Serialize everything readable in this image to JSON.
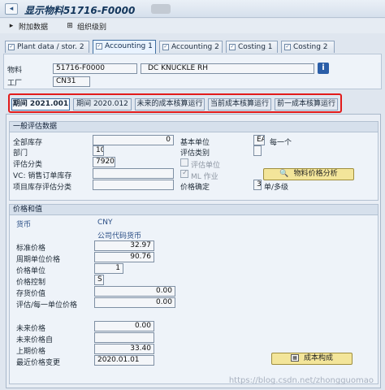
{
  "window": {
    "title": "显示物料51716-F0000"
  },
  "toolbar": {
    "append_data": "附加数据",
    "org_levels": "组织级别"
  },
  "tabs": [
    {
      "label": "Plant data / stor. 2"
    },
    {
      "label": "Accounting 1"
    },
    {
      "label": "Accounting 2"
    },
    {
      "label": "Costing 1"
    },
    {
      "label": "Costing 2"
    }
  ],
  "header": {
    "material_label": "物料",
    "material_value": "51716-F0000",
    "material_desc": "DC KNUCKLE RH",
    "plant_label": "工厂",
    "plant_value": "CN31",
    "info_button": "i"
  },
  "period_tabs": [
    {
      "label": "期间 2021.001"
    },
    {
      "label": "期间 2020.012"
    },
    {
      "label": "未来的成本核算运行"
    },
    {
      "label": "当前成本核算运行"
    },
    {
      "label": "前一成本核算运行"
    }
  ],
  "general": {
    "title": "一般评估数据",
    "total_stock_label": "全部库存",
    "total_stock_value": "0",
    "base_unit_label": "基本单位",
    "base_unit_value": "EA",
    "base_unit_text": "每一个",
    "division_label": "部门",
    "division_value": "10",
    "valuation_category_label": "评估类别",
    "valuation_class_label": "评估分类",
    "valuation_class_value": "7920",
    "valuated_unit_label": "评估单位",
    "vc_so_label": "VC: 销售订单库存",
    "ml_act_label": "ML 作业",
    "material_price_analysis": "物料价格分析",
    "proj_stock_label": "项目库存评估分类",
    "price_determination_label": "价格确定",
    "price_determination_value": "3",
    "price_determination_text": "单/多级"
  },
  "prices": {
    "title": "价格和值",
    "currency_label": "货币",
    "currency_value": "CNY",
    "company_code_currency": "公司代码货币",
    "std_price_label": "标准价格",
    "std_price_value": "32.97",
    "periodic_unit_price_label": "周期单位价格",
    "periodic_unit_price_value": "90.76",
    "price_unit_label": "价格单位",
    "price_unit_value": "1",
    "price_control_label": "价格控制",
    "price_control_value": "S",
    "stock_value_label": "存货价值",
    "stock_value_value": "0.00",
    "val_price_unit_label": "评估/每一单位价格",
    "val_price_unit_value": "0.00",
    "future_price_label": "未来价格",
    "future_price_value": "0.00",
    "future_price_from_label": "未来价格自",
    "prev_price_label": "上期价格",
    "prev_price_value": "33.40",
    "last_price_change_label": "最近价格变更",
    "last_price_change_value": "2020.01.01",
    "cost_structure_button": "成本构成"
  },
  "watermark": "https://blog.csdn.net/zhongguomao"
}
